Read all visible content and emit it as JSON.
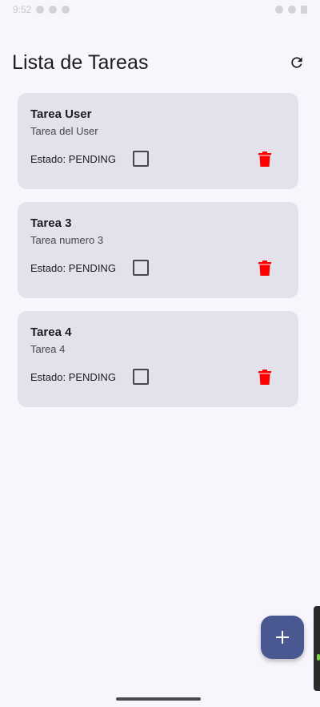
{
  "status_bar": {
    "time": "9:52",
    "icons": [
      "alert-icon",
      "shield-icon",
      "cloud-icon",
      "wifi-icon",
      "signal-icon",
      "battery-icon"
    ]
  },
  "app_bar": {
    "title": "Lista de Tareas",
    "refresh_icon": "refresh-icon"
  },
  "tasks": [
    {
      "title": "Tarea User",
      "description": "Tarea del User",
      "status": "Estado: PENDING",
      "checked": false
    },
    {
      "title": "Tarea 3",
      "description": "Tarea numero 3",
      "status": "Estado: PENDING",
      "checked": false
    },
    {
      "title": "Tarea 4",
      "description": "Tarea 4",
      "status": "Estado: PENDING",
      "checked": false
    }
  ],
  "fab": {
    "icon": "plus-icon"
  },
  "colors": {
    "background": "#f8f6fc",
    "card": "#e3e1ea",
    "delete": "#ff0000",
    "fab": "#4a5891"
  }
}
